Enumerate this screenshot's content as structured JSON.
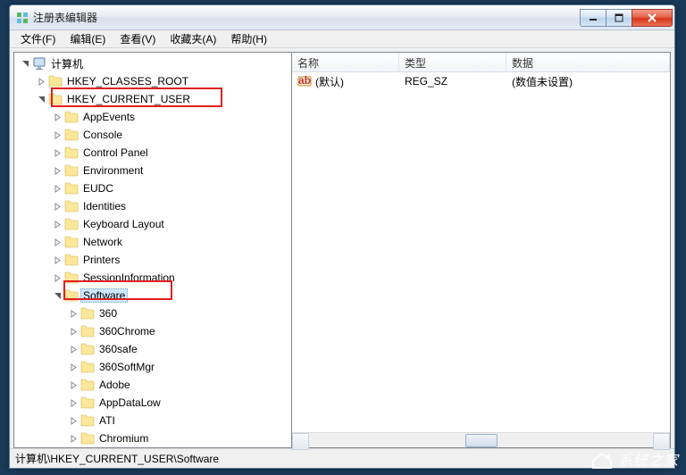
{
  "window": {
    "title": "注册表编辑器"
  },
  "menu": {
    "file": "文件(F)",
    "edit": "编辑(E)",
    "view": "查看(V)",
    "favorites": "收藏夹(A)",
    "help": "帮助(H)"
  },
  "tree": {
    "root": "计算机",
    "hkcr": "HKEY_CLASSES_ROOT",
    "hkcu": "HKEY_CURRENT_USER",
    "hkcu_children": [
      "AppEvents",
      "Console",
      "Control Panel",
      "Environment",
      "EUDC",
      "Identities",
      "Keyboard Layout",
      "Network",
      "Printers",
      "SessionInformation"
    ],
    "software": "Software",
    "software_children": [
      "360",
      "360Chrome",
      "360safe",
      "360SoftMgr",
      "Adobe",
      "AppDataLow",
      "ATI",
      "Chromium"
    ]
  },
  "list": {
    "col_name": "名称",
    "col_type": "类型",
    "col_data": "数据",
    "default_name": "(默认)",
    "default_type": "REG_SZ",
    "default_data": "(数值未设置)"
  },
  "statusbar": {
    "path": "计算机\\HKEY_CURRENT_USER\\Software"
  },
  "watermark": {
    "text": "系统之家"
  }
}
